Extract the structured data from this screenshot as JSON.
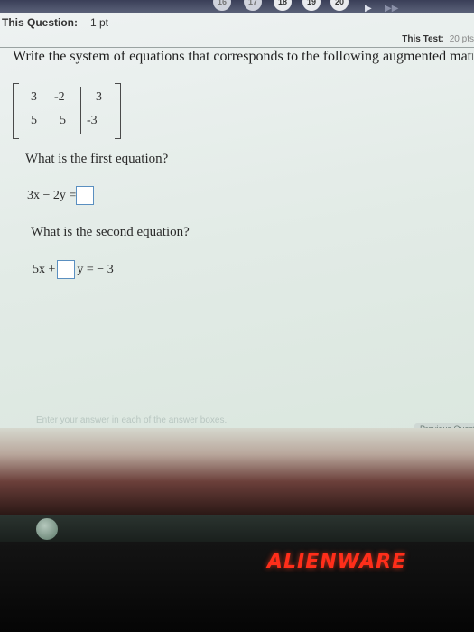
{
  "nav": {
    "question_numbers": [
      "16",
      "17",
      "18",
      "19",
      "20"
    ],
    "next_arrow": "▶",
    "last_arrow": "▶▶"
  },
  "header": {
    "this_question_label": "This Question:",
    "this_question_points": "1 pt",
    "this_test_label": "This Test:",
    "this_test_points": "20 pts"
  },
  "question": {
    "prompt": "Write the system of equations that corresponds to the following augmented matrix.",
    "matrix": {
      "row1": [
        "3",
        "-2",
        "3"
      ],
      "row2": [
        "5",
        "5",
        "-3"
      ]
    }
  },
  "part1": {
    "prompt": "What is the first equation?",
    "equation_left": "3x − 2y =",
    "answer_value": ""
  },
  "part2": {
    "prompt": "What is the second equation?",
    "equation_left": "5x +",
    "equation_right": "y = − 3",
    "answer_value": ""
  },
  "footer": {
    "hint": "Enter your answer in each of the answer boxes.",
    "previous_button": "Previous Question"
  },
  "device": {
    "brand_logo": "ALIENWARE"
  },
  "colors": {
    "logo": "#ff2e1a",
    "answer_box_border": "#5a8fc0"
  }
}
